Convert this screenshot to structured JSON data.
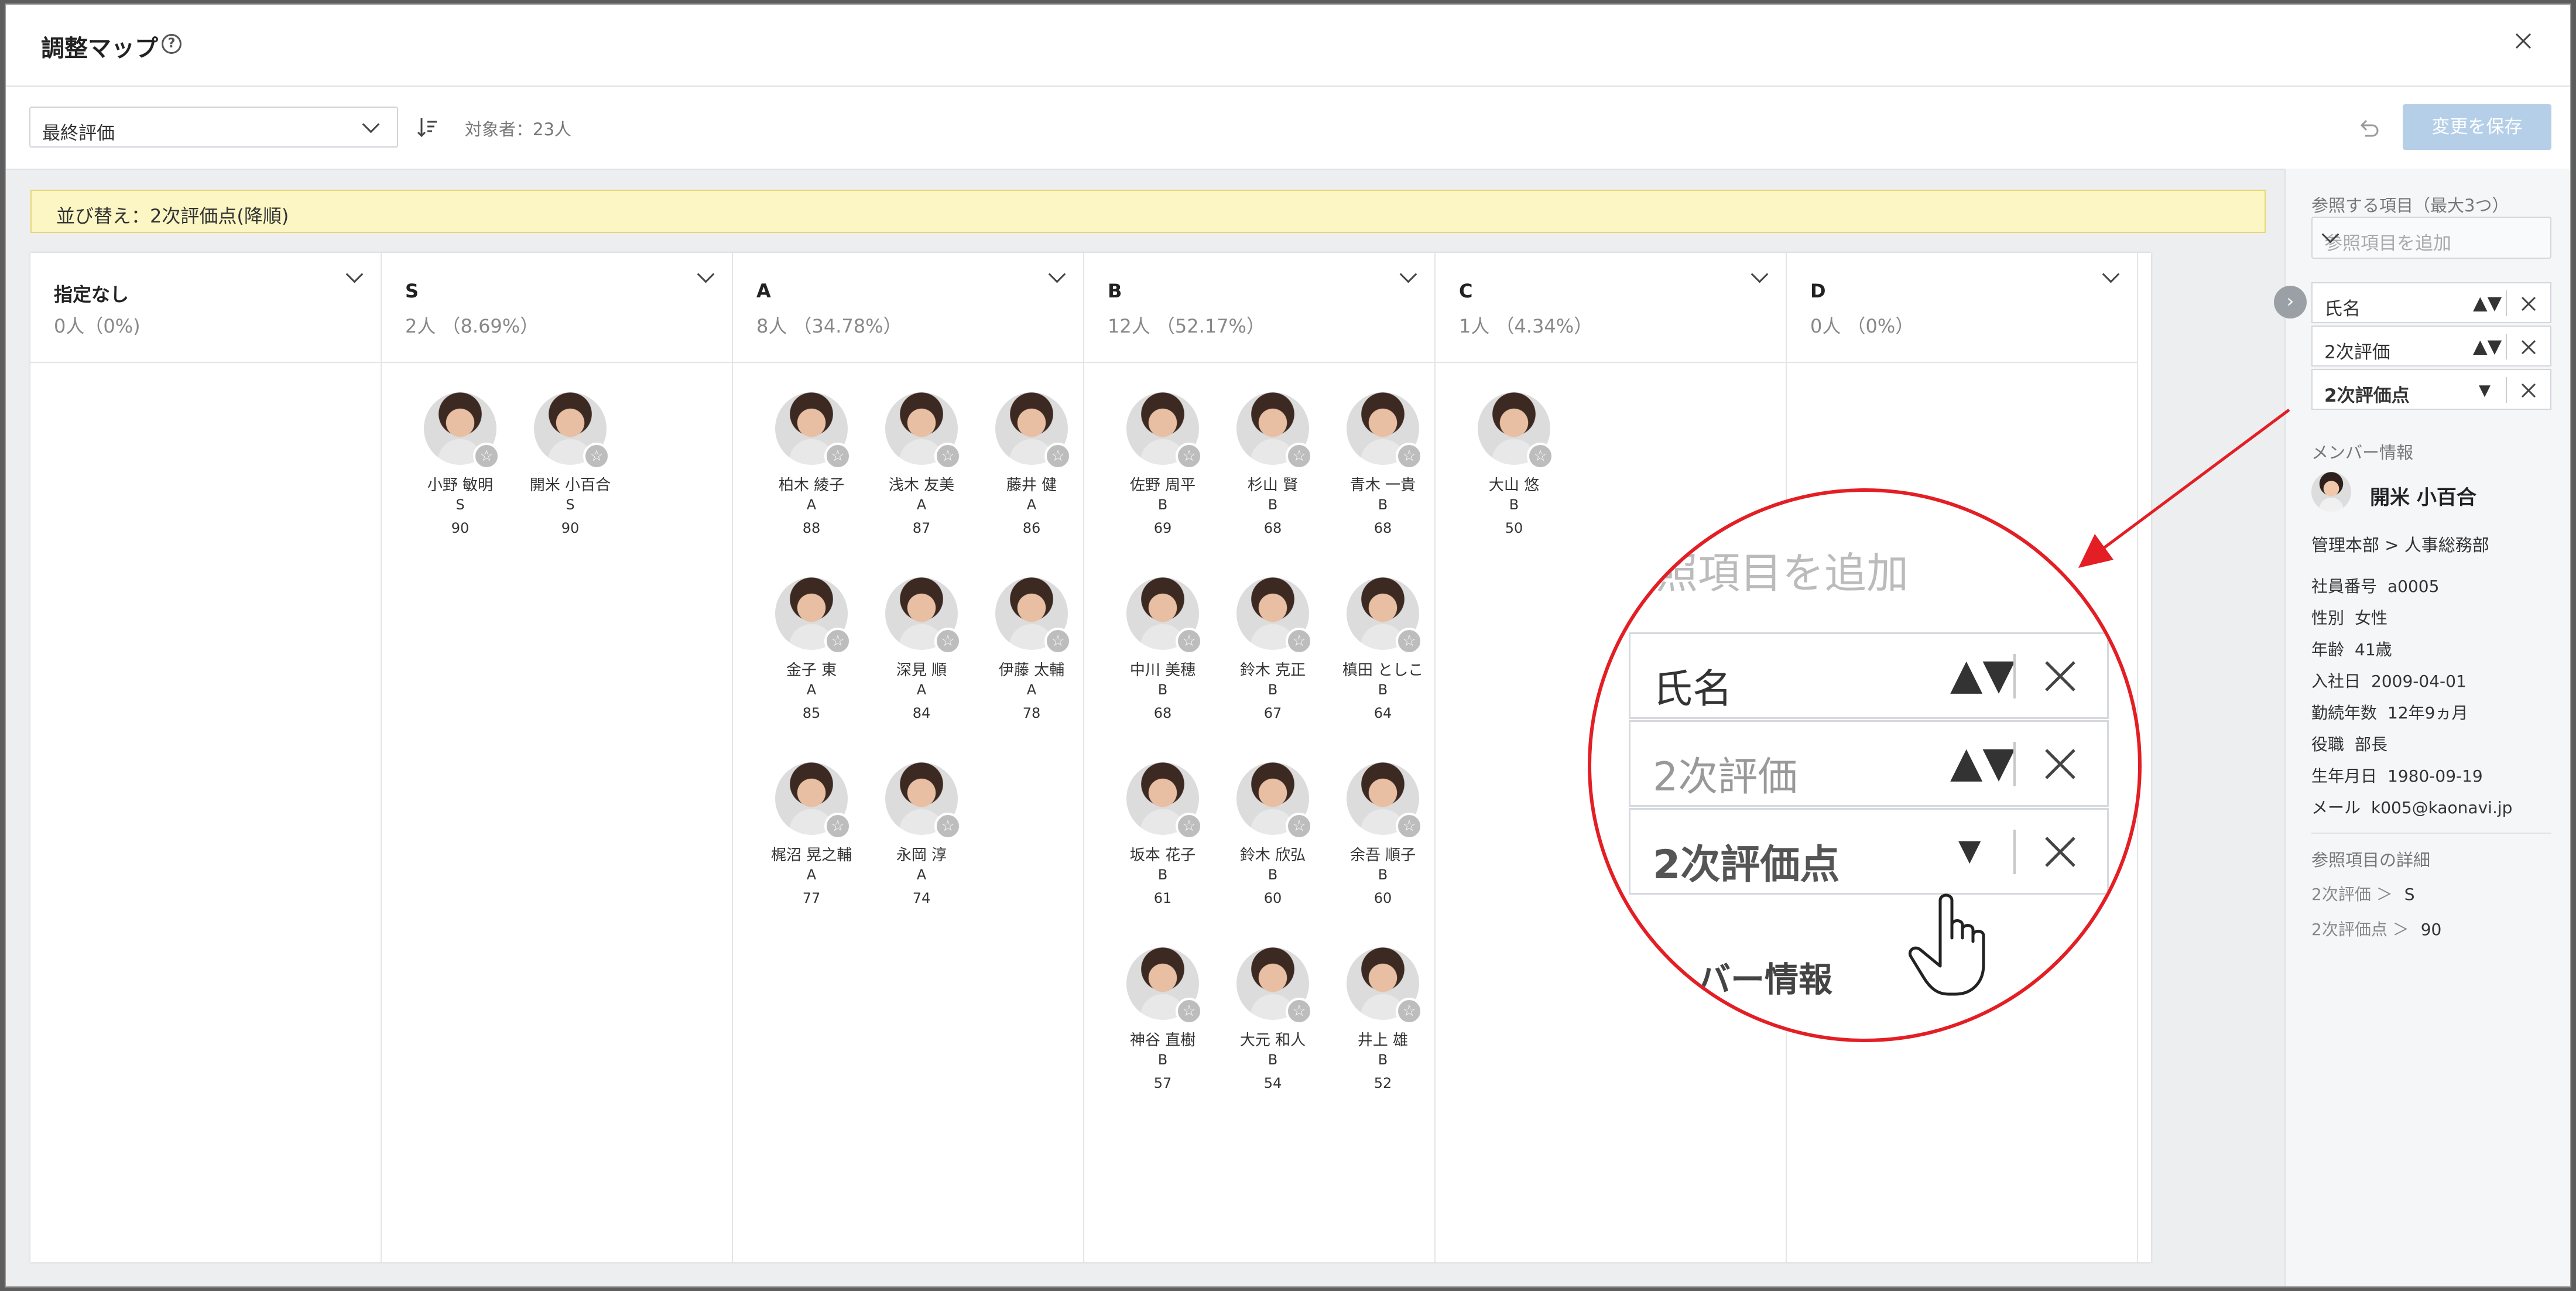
{
  "dialog": {
    "title": "調整マップ",
    "help_icon": "question-circle-icon",
    "close_icon": "close-icon"
  },
  "toolbar": {
    "eval_select_value": "最終評価",
    "sort_icon": "sort-descending-icon",
    "target_count": "対象者：23人",
    "undo_icon": "undo-icon",
    "save_label": "変更を保存"
  },
  "sort_banner": "並び替え：2次評価点(降順)",
  "columns": [
    {
      "title": "指定なし",
      "count": "0人（0%)",
      "cards": []
    },
    {
      "title": "S",
      "count": "2人 （8.69%）",
      "cards": [
        {
          "name": "小野 敏明",
          "grade": "S",
          "score": "90"
        },
        {
          "name": "開米 小百合",
          "grade": "S",
          "score": "90"
        }
      ]
    },
    {
      "title": "A",
      "count": "8人 （34.78%）",
      "cards": [
        {
          "name": "柏木 綾子",
          "grade": "A",
          "score": "88"
        },
        {
          "name": "浅木 友美",
          "grade": "A",
          "score": "87"
        },
        {
          "name": "藤井 健",
          "grade": "A",
          "score": "86"
        },
        {
          "name": "金子 東",
          "grade": "A",
          "score": "85"
        },
        {
          "name": "深見 順",
          "grade": "A",
          "score": "84"
        },
        {
          "name": "伊藤 太輔",
          "grade": "A",
          "score": "78"
        },
        {
          "name": "梶沼 晃之輔",
          "grade": "A",
          "score": "77"
        },
        {
          "name": "永岡 淳",
          "grade": "A",
          "score": "74"
        }
      ]
    },
    {
      "title": "B",
      "count": "12人 （52.17%）",
      "cards": [
        {
          "name": "佐野 周平",
          "grade": "B",
          "score": "69"
        },
        {
          "name": "杉山 賢",
          "grade": "B",
          "score": "68"
        },
        {
          "name": "青木 一貴",
          "grade": "B",
          "score": "68"
        },
        {
          "name": "中川 美穂",
          "grade": "B",
          "score": "68"
        },
        {
          "name": "鈴木 克正",
          "grade": "B",
          "score": "67"
        },
        {
          "name": "槙田 としこ",
          "grade": "B",
          "score": "64"
        },
        {
          "name": "坂本 花子",
          "grade": "B",
          "score": "61"
        },
        {
          "name": "鈴木 欣弘",
          "grade": "B",
          "score": "60"
        },
        {
          "name": "余吾 順子",
          "grade": "B",
          "score": "60"
        },
        {
          "name": "神谷 直樹",
          "grade": "B",
          "score": "57"
        },
        {
          "name": "大元 和人",
          "grade": "B",
          "score": "54"
        },
        {
          "name": "井上 雄",
          "grade": "B",
          "score": "52"
        }
      ]
    },
    {
      "title": "C",
      "count": "1人 （4.34%）",
      "cards": [
        {
          "name": "大山 悠",
          "grade": "B",
          "score": "50"
        }
      ]
    },
    {
      "title": "D",
      "count": "0人 （0%）",
      "cards": []
    }
  ],
  "card_star_icon": "star-icon",
  "side_panel": {
    "ref_heading": "参照する項目（最大3つ）",
    "add_placeholder": "参照項目を追加",
    "ref_items": [
      {
        "label": "氏名",
        "arrow": "▲▼"
      },
      {
        "label": "2次評価",
        "arrow": "▲▼"
      },
      {
        "label": "2次評価点",
        "arrow": "▼"
      }
    ],
    "member_heading": "メンバー情報",
    "member_name": "開米 小百合",
    "member_dept": "管理本部 > 人事総務部",
    "member_info": [
      {
        "k": "社員番号",
        "v": "a0005"
      },
      {
        "k": "性別",
        "v": "女性"
      },
      {
        "k": "年齢",
        "v": "41歳"
      },
      {
        "k": "入社日",
        "v": "2009-04-01"
      },
      {
        "k": "勤続年数",
        "v": "12年9ヵ月"
      },
      {
        "k": "役職",
        "v": "部長"
      },
      {
        "k": "生年月日",
        "v": "1980-09-19"
      },
      {
        "k": "メール",
        "v": "k005@kaonavi.jp"
      }
    ],
    "detail_heading": "参照項目の詳細",
    "details": [
      {
        "k": "2次評価 ＞",
        "v": "S"
      },
      {
        "k": "2次評価点 ＞",
        "v": "90"
      }
    ],
    "expand_icon": "chevron-right-icon"
  },
  "zoom": {
    "add_text": "照項目を追加",
    "member_text": "バー情報",
    "hand_icon": "pointer-hand-icon"
  },
  "colors": {
    "accent_disabled": "#b5cfe9",
    "banner_bg": "#fcf6c4",
    "annotation_red": "#e31e24"
  }
}
